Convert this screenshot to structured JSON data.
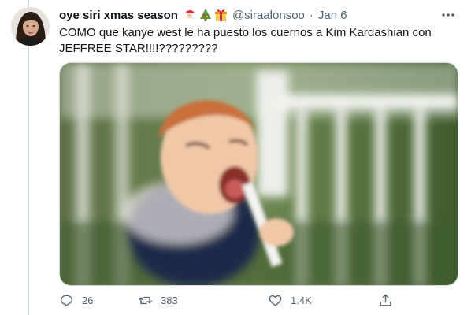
{
  "tweet": {
    "display_name": "oye siri xmas season",
    "name_emojis": [
      "santa-emoji",
      "christmas-tree-emoji",
      "gift-emoji"
    ],
    "handle": "@siraalonsoo",
    "separator": "·",
    "date": "Jan 6",
    "text": "COMO que kanye west le ha puesto los cuernos a Kim Kardashian con JEFFREE STAR!!!!?????????",
    "media": {
      "type": "gif",
      "description_icon": "screaming-toddler-gif"
    }
  },
  "actions": {
    "reply_count": "26",
    "retweet_count": "383",
    "like_count": "1.4K",
    "icons": [
      "reply-icon",
      "retweet-icon",
      "like-icon",
      "share-icon"
    ]
  },
  "colors": {
    "text": "#0f1419",
    "muted": "#536471",
    "border": "#cfd9de",
    "background": "#ffffff"
  }
}
